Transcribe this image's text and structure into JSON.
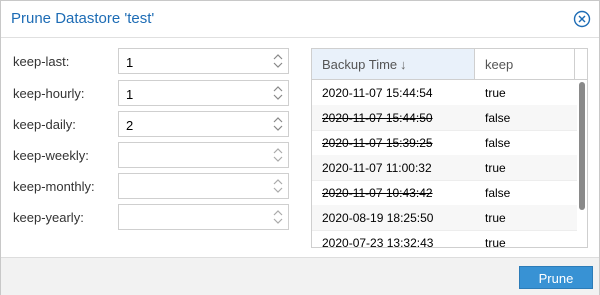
{
  "dialog": {
    "title": "Prune Datastore 'test'"
  },
  "form": {
    "fields": [
      {
        "label": "keep-last:",
        "value": "1"
      },
      {
        "label": "keep-hourly:",
        "value": "1"
      },
      {
        "label": "keep-daily:",
        "value": "2"
      },
      {
        "label": "keep-weekly:",
        "value": ""
      },
      {
        "label": "keep-monthly:",
        "value": ""
      },
      {
        "label": "keep-yearly:",
        "value": ""
      }
    ]
  },
  "grid": {
    "columns": {
      "time": "Backup Time",
      "sort": "↓",
      "keep": "keep"
    },
    "rows": [
      {
        "time": "2020-11-07 15:44:54",
        "keep": "true",
        "struck": false
      },
      {
        "time": "2020-11-07 15:44:50",
        "keep": "false",
        "struck": true
      },
      {
        "time": "2020-11-07 15:39:25",
        "keep": "false",
        "struck": true
      },
      {
        "time": "2020-11-07 11:00:32",
        "keep": "true",
        "struck": false
      },
      {
        "time": "2020-11-07 10:43:42",
        "keep": "false",
        "struck": true
      },
      {
        "time": "2020-08-19 18:25:50",
        "keep": "true",
        "struck": false
      },
      {
        "time": "2020-07-23 13:32:43",
        "keep": "true",
        "struck": false
      }
    ]
  },
  "footer": {
    "prune_label": "Prune"
  },
  "icons": {
    "close": "close-icon",
    "spinner": "spinner-arrows-icon"
  },
  "colors": {
    "accent": "#1d6cb5",
    "button": "#3892d4",
    "header_active": "#e9f1fa"
  }
}
